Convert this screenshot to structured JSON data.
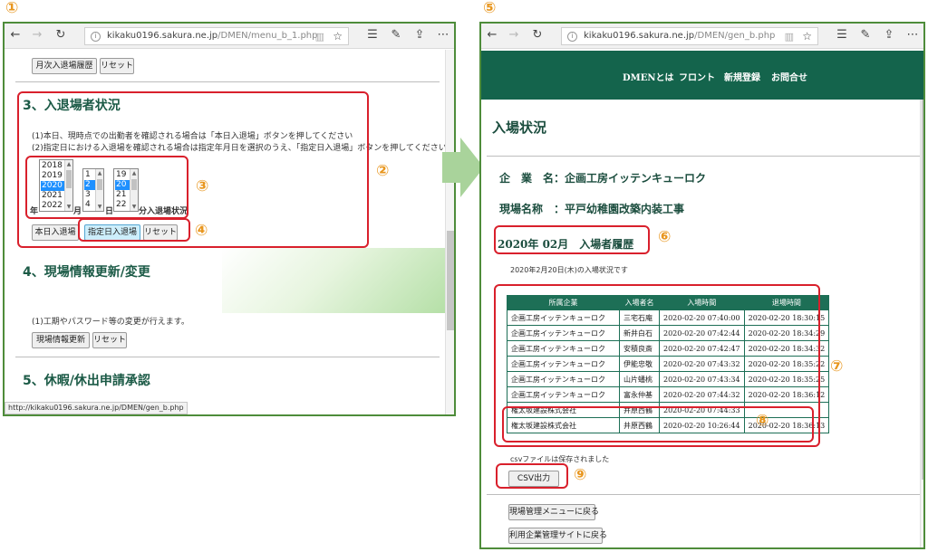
{
  "markers": {
    "m1": "①",
    "m2": "②",
    "m3": "③",
    "m4": "④",
    "m5": "⑤",
    "m6": "⑥",
    "m7": "⑦",
    "m8": "⑧",
    "m9": "⑨"
  },
  "left": {
    "url_host": "kikaku0196.sakura.ne.jp",
    "url_path": "/DMEN/menu_b_1.php",
    "buttons": {
      "monthly_history": "月次入退場履歴",
      "reset_top": "リセット",
      "today_entry": "本日入退場",
      "date_entry": "指定日入退場",
      "reset_mid": "リセット",
      "site_update": "現場情報更新",
      "reset_bottom": "リセット"
    },
    "section3": {
      "title": "3、入退場者状況",
      "desc1": "(1)本日、現時点での出勤者を確認される場合は「本日入退場」ボタンを押してください",
      "desc2": "(2)指定日における入退場を確認される場合は指定年月日を選択のうえ、「指定日入退場」ボタンを押してください"
    },
    "selectors": {
      "years": [
        "2018",
        "2019",
        "2020",
        "2021",
        "2022"
      ],
      "selected_year": "2020",
      "months": [
        "1",
        "2",
        "3",
        "4"
      ],
      "selected_month": "2",
      "days": [
        "19",
        "20",
        "21",
        "22"
      ],
      "selected_day": "20",
      "label_year": "年",
      "label_month": "月",
      "label_day": "日",
      "label_suffix": "分入退場状況"
    },
    "section4": {
      "title": "4、現場情報更新/変更",
      "desc": "(1)工期やパスワード等の変更が行えます。"
    },
    "section5": {
      "title": "5、休暇/休出申請承認"
    },
    "status_url": "http://kikaku0196.sakura.ne.jp/DMEN/gen_b.php"
  },
  "right": {
    "url_host": "kikaku0196.sakura.ne.jp",
    "url_path": "/DMEN/gen_b.php",
    "nav": [
      "DMENとは",
      "フロント",
      "新規登録",
      "お問合せ"
    ],
    "page_title": "入場状況",
    "company_label": "企　業　名：",
    "company_value": "企画工房イッテンキューロク",
    "site_label": "現場名称　：",
    "site_value": "平戸幼稚園改築内装工事",
    "month_title": "2020年 02月　入場者履歴",
    "date_note": "2020年2月20日(木)の入場状況です",
    "table": {
      "headers": [
        "所属企業",
        "入場者名",
        "入場時間",
        "退場時間"
      ],
      "rows": [
        [
          "企画工房イッテンキューロク",
          "三宅石庵",
          "2020-02-20 07:40:00",
          "2020-02-20 18:30:15"
        ],
        [
          "企画工房イッテンキューロク",
          "新井白石",
          "2020-02-20 07:42:44",
          "2020-02-20 18:34:29"
        ],
        [
          "企画工房イッテンキューロク",
          "安積良斎",
          "2020-02-20 07:42:47",
          "2020-02-20 18:34:32"
        ],
        [
          "企画工房イッテンキューロク",
          "伊能忠敬",
          "2020-02-20 07:43:32",
          "2020-02-20 18:35:22"
        ],
        [
          "企画工房イッテンキューロク",
          "山片蟠桃",
          "2020-02-20 07:43:34",
          "2020-02-20 18:35:25"
        ],
        [
          "企画工房イッテンキューロク",
          "富永仲基",
          "2020-02-20 07:44:32",
          "2020-02-20 18:36:12"
        ],
        [
          "権太坂建設株式会社",
          "井原西鶴",
          "2020-02-20 07:44:33",
          ""
        ],
        [
          "権太坂建設株式会社",
          "井原西鶴",
          "2020-02-20 10:26:44",
          "2020-02-20 18:36:13"
        ]
      ]
    },
    "csv_saved": "csvファイルは保存されました",
    "csv_button": "CSV出力",
    "back_site_menu": "現場管理メニューに戻る",
    "back_company_site": "利用企業管理サイトに戻る"
  },
  "colors": {
    "frame_green": "#4e8c3a",
    "accent_red": "#d9202c",
    "marker_orange": "#e8961e",
    "banner_green": "#14644c"
  }
}
